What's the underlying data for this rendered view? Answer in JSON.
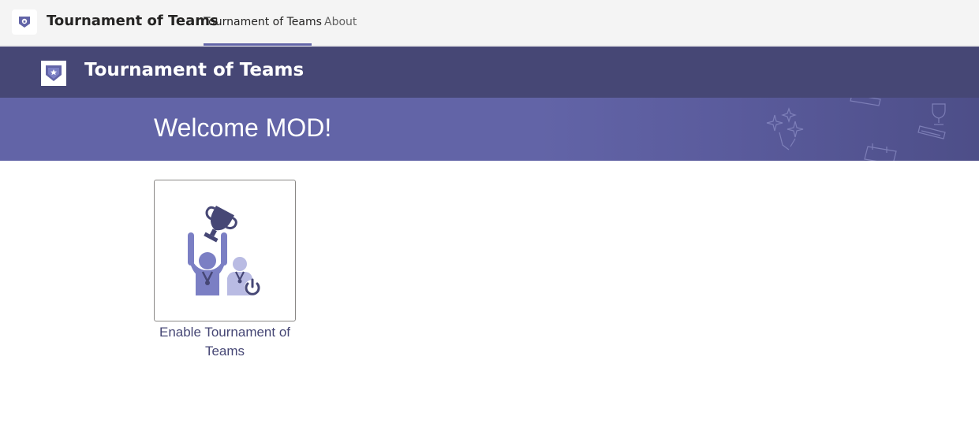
{
  "topbar": {
    "app_icon": "tournament-shield-icon",
    "app_title": "Tournament of Teams",
    "tabs": [
      {
        "label": "Tournament of Teams",
        "active": true
      },
      {
        "label": "About",
        "active": false
      }
    ]
  },
  "header": {
    "logo_icon": "tournament-shield-icon",
    "title": "Tournament of Teams"
  },
  "banner": {
    "welcome_text": "Welcome MOD!",
    "decoration_icons": [
      "fireworks-icon",
      "trophy-icon",
      "calendar-icon"
    ]
  },
  "tiles": [
    {
      "icon": "trophy-winner-power-icon",
      "label": "Enable Tournament of Teams"
    }
  ],
  "colors": {
    "brand": "#6264a7",
    "header_dark": "#464775",
    "topbar_bg": "#f4f4f4",
    "tile_figure_primary": "#7b7fc4",
    "tile_figure_secondary": "#b9bbe3",
    "tile_trophy": "#464775"
  }
}
